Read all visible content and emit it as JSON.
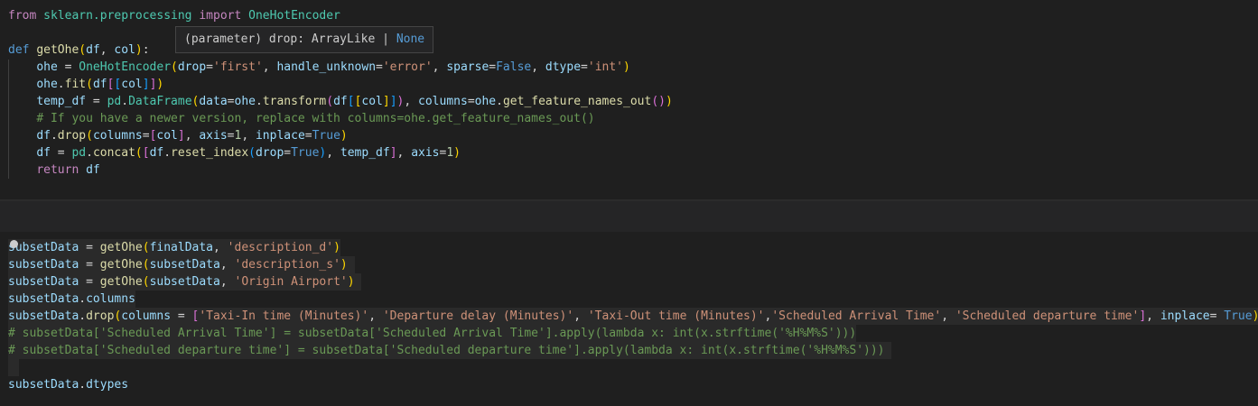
{
  "hover": {
    "text": "(parameter) drop: ArrayLike | ",
    "tail": "None"
  },
  "cell1": {
    "line1": {
      "from": "from",
      "module": "sklearn.preprocessing",
      "import": "import",
      "cls": "OneHotEncoder"
    },
    "line3": {
      "def": "def",
      "fn": "getOhe",
      "p1": "df",
      "p2": "col"
    },
    "line4": {
      "v": "ohe",
      "cls": "OneHotEncoder",
      "a1": "drop",
      "s1": "'first'",
      "a2": "handle_unknown",
      "s2": "'error'",
      "a3": "sparse",
      "k3": "False",
      "a4": "dtype",
      "s4": "'int'"
    },
    "line5": {
      "v": "ohe",
      "fn": "fit",
      "a": "df",
      "b": "col"
    },
    "line6": {
      "v": "temp_df",
      "mod": "pd",
      "cls": "DataFrame",
      "a1": "data",
      "v2": "ohe",
      "fn2": "transform",
      "a": "df",
      "b": "col",
      "a2": "columns",
      "v3": "ohe",
      "fn3": "get_feature_names_out"
    },
    "line7": {
      "comment": "# If you have a newer version, replace with columns=ohe.get_feature_names_out()"
    },
    "line8": {
      "v": "df",
      "fn": "drop",
      "a1": "columns",
      "b": "col",
      "a2": "axis",
      "n": "1",
      "a3": "inplace",
      "k": "True"
    },
    "line9": {
      "v": "df",
      "mod": "pd",
      "fn": "concat",
      "a": "df",
      "fn2": "reset_index",
      "a1": "drop",
      "k": "True",
      "b": "temp_df",
      "a2": "axis",
      "n": "1"
    },
    "line10": {
      "ret": "return",
      "v": "df"
    }
  },
  "cell2": {
    "line1": {
      "v": "subsetData",
      "fn": "getOhe",
      "a": "finalData",
      "s": "'description_d'"
    },
    "line2": {
      "v": "subsetData",
      "fn": "getOhe",
      "a": "subsetData",
      "s": "'description_s'"
    },
    "line3": {
      "v": "subsetData",
      "fn": "getOhe",
      "a": "subsetData",
      "s": "'Origin Airport'"
    },
    "line4": {
      "v": "subsetData",
      "attr": "columns"
    },
    "line5": {
      "v": "subsetData",
      "fn": "drop",
      "a1": "columns",
      "s1": "'Taxi-In time (Minutes)'",
      "s2": "'Departure delay (Minutes)'",
      "s3": "'Taxi-Out time (Minutes)'",
      "s4": "'Scheduled Arrival Time'",
      "s5": "'Scheduled departure time'",
      "a2": "inplace",
      "k": "True"
    },
    "line6": {
      "comment": "# subsetData['Scheduled Arrival Time'] = subsetData['Scheduled Arrival Time'].apply(lambda x: int(x.strftime('%H%M%S')))"
    },
    "line7": {
      "comment": "# subsetData['Scheduled departure time'] = subsetData['Scheduled departure time'].apply(lambda x: int(x.strftime('%H%M%S')))"
    },
    "line9": {
      "v": "subsetData",
      "attr": "dtypes"
    }
  },
  "colors": {
    "background": "#1f1f1f",
    "keyword": "#569cd6",
    "control": "#c586c0",
    "function": "#dcdcaa",
    "class": "#4ec9b0",
    "variable": "#9cdcfe",
    "string": "#ce9178",
    "comment": "#6a9955"
  }
}
